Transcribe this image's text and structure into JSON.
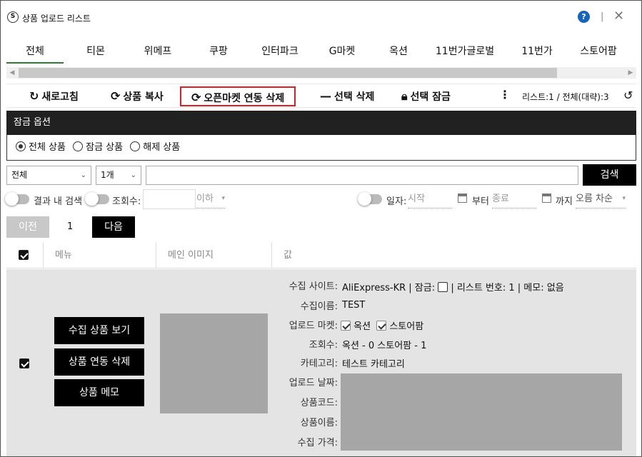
{
  "window": {
    "title": "상품 업로드 리스트",
    "help": "?",
    "separator": "|",
    "close": "✕"
  },
  "tabs": [
    "전체",
    "티몬",
    "위메프",
    "쿠팡",
    "인터파크",
    "G마켓",
    "옥션",
    "11번가글로벌",
    "11번가",
    "스토어팜"
  ],
  "toolbar": {
    "refresh": "새로고침",
    "copy": "상품 복사",
    "openmarket_delete": "오픈마켓 연동 삭제",
    "select_delete": "선택 삭제",
    "select_lock": "선택 잠금",
    "more": "⋮",
    "count": "리스트:1  /  전체(대략):3"
  },
  "lock_options": {
    "title": "잠금 옵션",
    "options": [
      "전체 상품",
      "잠금 상품",
      "해제 상품"
    ],
    "selected": "전체 상품"
  },
  "search": {
    "category_select": "전체",
    "count_select": "1개",
    "query": "",
    "button": "검색"
  },
  "filters": {
    "within_results": "결과 내 검색",
    "views_label": "조회수:",
    "views_value": "",
    "below": "이하",
    "date_label": "일자:",
    "start": "시작",
    "from": "부터",
    "end": "종료",
    "until": "까지",
    "sort": "오름 차순"
  },
  "pager": {
    "prev": "이전",
    "page": "1",
    "next": "다음"
  },
  "table": {
    "headers": [
      "메뉴",
      "메인 이미지",
      "값"
    ],
    "row": {
      "buttons": [
        "수집 상품 보기",
        "상품 연동 삭제",
        "상품 메모"
      ],
      "fields": {
        "site_label": "수집 사이트:",
        "site_value": "AliExpress-KR",
        "lock_label": "잠금:",
        "list_no_label": "리스트 번호:",
        "list_no": "1",
        "memo_label": "메모:",
        "memo": "없음",
        "name_label": "수집이름:",
        "name_value": "TEST",
        "market_label": "업로드 마켓:",
        "market_1": "옥션",
        "market_2": "스토어팜",
        "views_label": "조회수:",
        "views_value": "옥션 - 0 스토어팜 - 1",
        "category_label": "카테고리:",
        "category_value": "테스트 카테고리",
        "upload_date_label": "업로드 날짜:",
        "product_code_label": "상품코드:",
        "product_name_label": "상품이름:",
        "price_label": "수집 가격:"
      }
    }
  }
}
